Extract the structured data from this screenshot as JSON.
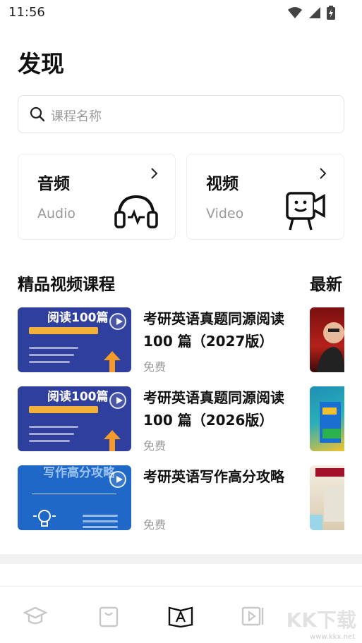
{
  "status_bar": {
    "time": "11:56"
  },
  "page": {
    "title": "发现"
  },
  "search": {
    "placeholder": "课程名称"
  },
  "cards": [
    {
      "title": "音频",
      "subtitle": "Audio",
      "icon": "headphones-icon"
    },
    {
      "title": "视频",
      "subtitle": "Video",
      "icon": "video-camera-icon"
    }
  ],
  "sections": {
    "left_title": "精品视频课程",
    "right_title": "最新"
  },
  "courses": [
    {
      "title": "考研英语真题同源阅读 100 篇（2027版）",
      "price": "免费",
      "thumb_text": "阅读100篇"
    },
    {
      "title": "考研英语真题同源阅读 100 篇（2026版）",
      "price": "免费",
      "thumb_text": "阅读100篇"
    },
    {
      "title": "考研英语写作高分攻略",
      "price": "免费",
      "thumb_text": "写作高分攻略"
    }
  ],
  "tabbar": {
    "icons": [
      "graduation-cap-icon",
      "bag-icon",
      "book-icon",
      "video-play-icon"
    ]
  },
  "watermark": {
    "text": "KK下载",
    "url": "www.kkx.net"
  },
  "colors": {
    "thumb_blue": "#2f3f9e",
    "thumb_light_blue": "#1f68c8",
    "accent_orange": "#f2b23a"
  }
}
